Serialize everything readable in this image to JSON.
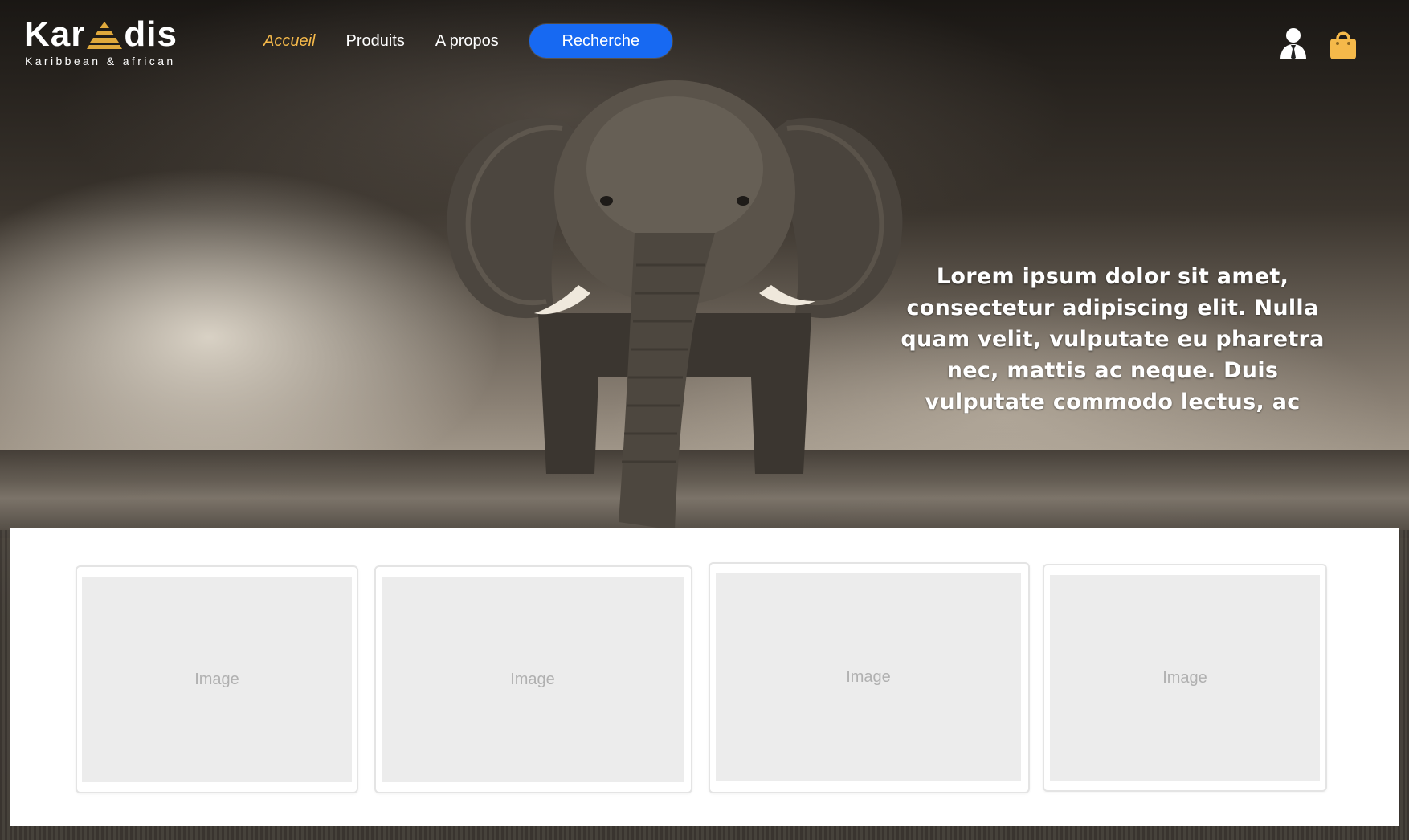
{
  "brand": {
    "name_left": "Kar",
    "name_right": "dis",
    "tagline": "Karibbean & african",
    "accent_color": "#f5b94a"
  },
  "nav": {
    "items": [
      {
        "label": "Accueil",
        "active": true
      },
      {
        "label": "Produits",
        "active": false
      },
      {
        "label": "A propos",
        "active": false
      }
    ],
    "search_label": "Recherche",
    "search_color": "#1769f2"
  },
  "header_icons": {
    "account": "user-icon",
    "cart": "shopping-bag-icon",
    "cart_color": "#f5b94a"
  },
  "hero": {
    "text": "Lorem ipsum dolor sit amet, consectetur adipiscing elit. Nulla quam velit, vulputate eu pharetra nec, mattis ac neque. Duis vulputate commodo lectus, ac"
  },
  "cards": [
    {
      "image_label": "Image"
    },
    {
      "image_label": "Image"
    },
    {
      "image_label": "Image"
    },
    {
      "image_label": "Image"
    }
  ]
}
